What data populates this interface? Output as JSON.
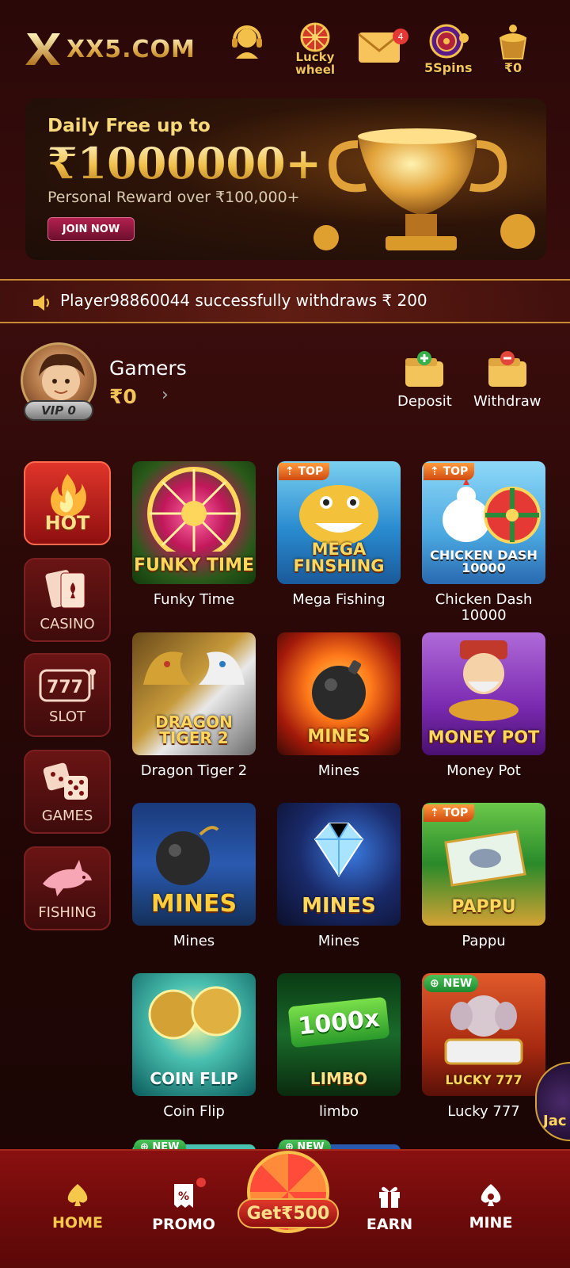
{
  "header": {
    "logo_text": "XX5.COM",
    "icons": [
      {
        "name": "support",
        "label": ""
      },
      {
        "name": "lucky-wheel",
        "label": "Lucky wheel"
      },
      {
        "name": "messages",
        "label": "",
        "badge": "4"
      },
      {
        "name": "spins",
        "label": "5Spins"
      },
      {
        "name": "treasure",
        "label": "₹0"
      }
    ]
  },
  "banner": {
    "line1": "Daily Free up to",
    "line2": "₹1000000+",
    "line3": "Personal Reward over ₹100,000+",
    "cta": "JOIN NOW"
  },
  "marquee": {
    "message": "Player98860044 successfully withdraws ₹ 200"
  },
  "user": {
    "name": "Gamers",
    "balance": "₹0",
    "vip": "VIP 0",
    "deposit_label": "Deposit",
    "withdraw_label": "Withdraw"
  },
  "categories": [
    {
      "label": "HOT",
      "active": true
    },
    {
      "label": "CASINO",
      "active": false
    },
    {
      "label": "SLOT",
      "active": false
    },
    {
      "label": "GAMES",
      "active": false
    },
    {
      "label": "FISHING",
      "active": false
    }
  ],
  "games": [
    {
      "name": "Funky Time",
      "thumb_title": "FUNKY TIME",
      "tag": ""
    },
    {
      "name": "Mega Fishing",
      "thumb_title": "MEGA FINSHING",
      "tag": "TOP"
    },
    {
      "name": "Chicken Dash 10000",
      "thumb_title": "CHICKEN DASH 10000",
      "tag": "TOP"
    },
    {
      "name": "Dragon Tiger 2",
      "thumb_title": "DRAGON TIGER 2",
      "tag": ""
    },
    {
      "name": "Mines",
      "thumb_title": "MINES",
      "tag": ""
    },
    {
      "name": "Money Pot",
      "thumb_title": "MONEY POT",
      "tag": ""
    },
    {
      "name": "Mines",
      "thumb_title": "MINES",
      "tag": ""
    },
    {
      "name": "Mines",
      "thumb_title": "MINES",
      "tag": ""
    },
    {
      "name": "Pappu",
      "thumb_title": "PAPPU",
      "tag": "TOP"
    },
    {
      "name": "Coin Flip",
      "thumb_title": "COIN FLIP",
      "tag": ""
    },
    {
      "name": "limbo",
      "thumb_title": "LIMBO",
      "tag": ""
    },
    {
      "name": "Lucky 777",
      "thumb_title": "LUCKY 777",
      "tag": "NEW"
    }
  ],
  "next_row_tags": [
    "NEW",
    "NEW"
  ],
  "jackpot_partial": "Jac",
  "bottom_nav": {
    "home": "HOME",
    "promo": "PROMO",
    "center": "Get₹500",
    "earn": "EARN",
    "mine": "MINE"
  }
}
